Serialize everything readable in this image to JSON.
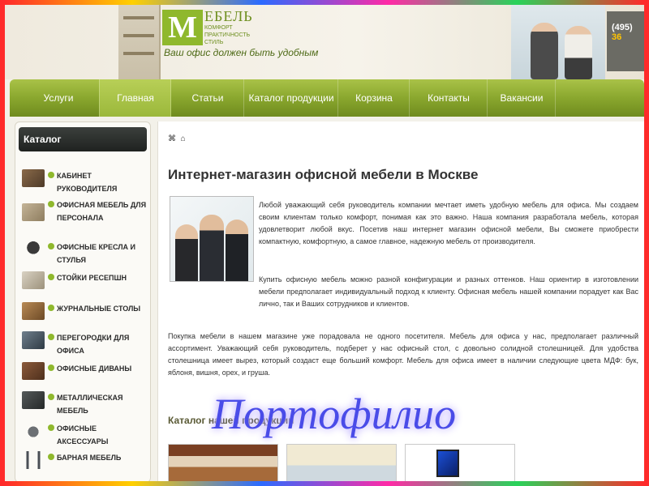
{
  "header": {
    "logo_letter": "M",
    "logo_word": "ЕБЕЛЬ",
    "logo_tagline": "КОМФОРТ ПРАКТИЧНОСТЬ СТИЛЬ",
    "slogan": "Ваш офис должен быть удобным",
    "phone_code": "(495)",
    "phone_digits": "36"
  },
  "nav": {
    "items": [
      "Услуги",
      "Главная",
      "Статьи",
      "Каталог продукции",
      "Корзина",
      "Контакты",
      "Вакансии"
    ],
    "active_index": 1
  },
  "sidebar": {
    "title": "Каталог",
    "items": [
      "КАБИНЕТ РУКОВОДИТЕЛЯ",
      "ОФИСНАЯ МЕБЕЛЬ ДЛЯ ПЕРСОНАЛА",
      "ОФИСНЫЕ КРЕСЛА И СТУЛЬЯ",
      "СТОЙКИ РЕСЕПШН",
      "ЖУРНАЛЬНЫЕ СТОЛЫ",
      "ПЕРЕГОРОДКИ ДЛЯ ОФИСА",
      "ОФИСНЫЕ ДИВАНЫ",
      "МЕТАЛЛИЧЕСКАЯ МЕБЕЛЬ",
      "ОФИСНЫЕ АКСЕССУАРЫ",
      "БАРНАЯ МЕБЕЛЬ"
    ]
  },
  "content": {
    "breadcrumb": "⌂",
    "title": "Интернет-магазин офисной мебели в Москве",
    "para1": "Любой уважающий себя руководитель компании мечтает иметь удобную мебель для офиса. Мы создаем своим клиентам только комфорт, понимая как это важно. Наша компания разработала мебель, которая удовлетворит любой вкус. Посетив наш интернет магазин офисной мебели, Вы сможете приобрести компактную, комфортную, а самое главное, надежную мебель от производителя.",
    "para2": "Купить офисную мебель можно разной конфигурации и разных оттенков. Наш ориентир в изготовлении мебели предполагает индивидуальный подход к клиенту. Офисная мебель нашей компании порадует как Вас лично, так и Ваших сотрудников и клиентов.",
    "para3": "Покупка мебели в нашем магазине уже порадовала не одного посетителя. Мебель для офиса у нас, предполагает различный ассортимент. Уважающий себя руководитель, подберет у нас офисный стол, с довольно солидной столешницей. Для удобства столешница имеет вырез, который создаст еще больший комфорт. Мебель для офиса имеет в наличии следующие цвета МДФ: бук, яблоня, вишня, орех, и груша.",
    "catalog_title": "Каталог нашей продукции"
  },
  "watermark": "Портофилио",
  "colors": {
    "accent_green": "#8fb82d",
    "nav_green": "#8aa72e",
    "watermark_blue": "#4a4ce8"
  }
}
